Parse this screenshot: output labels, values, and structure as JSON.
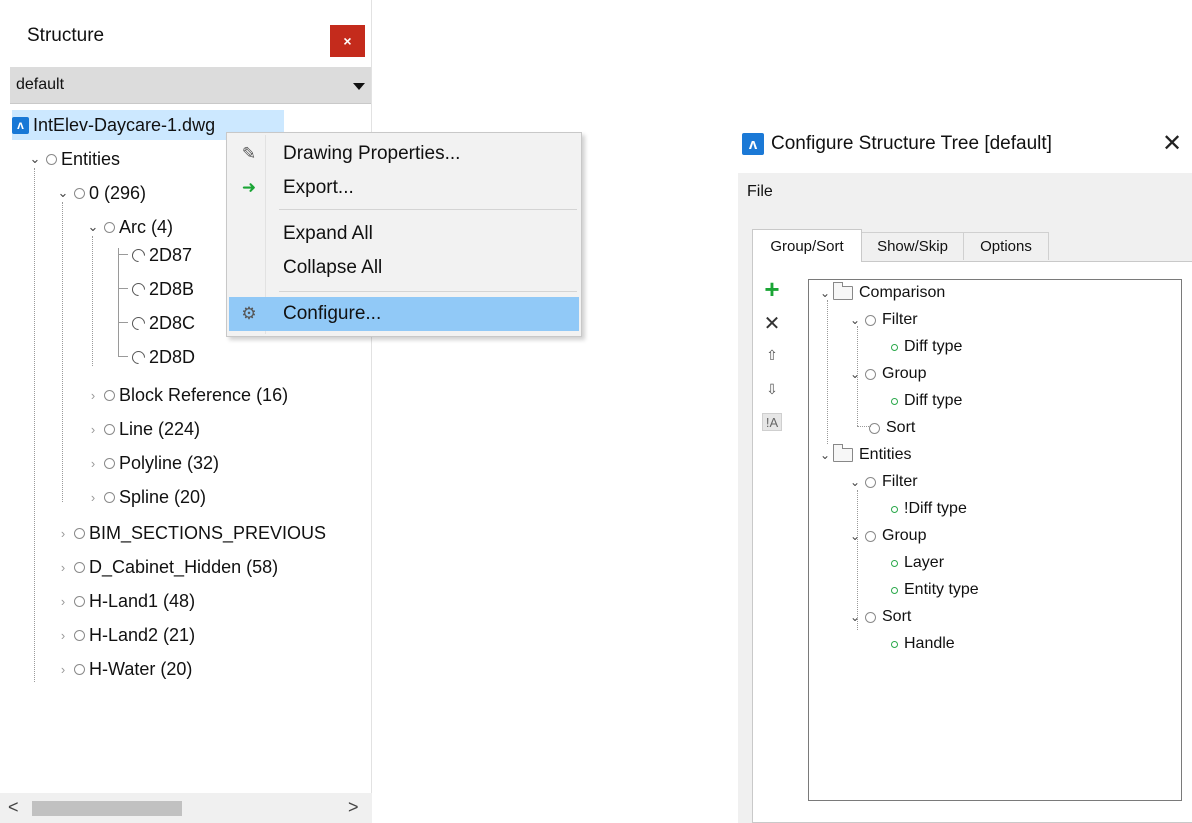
{
  "structure_panel": {
    "title": "Structure",
    "close_label": "×",
    "dropdown_value": "default",
    "tree": {
      "root": "IntElev-Daycare-1.dwg",
      "entities": "Entities",
      "layer0": "0 (296)",
      "arc": "Arc (4)",
      "arc_items": [
        "2D87",
        "2D8B",
        "2D8C",
        "2D8D"
      ],
      "block_reference": "Block Reference (16)",
      "line": "Line (224)",
      "polyline": "Polyline (32)",
      "spline": "Spline (20)",
      "bim_sections": "BIM_SECTIONS_PREVIOUS",
      "d_cabinet": "D_Cabinet_Hidden (58)",
      "h_land1": "H-Land1 (48)",
      "h_land2": "H-Land2 (21)",
      "h_water": "H-Water (20)"
    },
    "scroll_left": "<",
    "scroll_right": ">"
  },
  "context_menu": {
    "items": [
      {
        "label": "Drawing Properties...",
        "icon": "properties-icon"
      },
      {
        "label": "Export...",
        "icon": "export-icon"
      },
      {
        "label": "Expand All",
        "icon": ""
      },
      {
        "label": "Collapse All",
        "icon": ""
      },
      {
        "label": "Configure...",
        "icon": "gear-icon",
        "highlighted": true
      }
    ]
  },
  "configure_dialog": {
    "title": "Configure Structure Tree [default]",
    "close_label": "✕",
    "menu": {
      "file": "File"
    },
    "tabs": [
      "Group/Sort",
      "Show/Skip",
      "Options"
    ],
    "active_tab": "Group/Sort",
    "side_buttons": {
      "add": "+",
      "remove": "✕",
      "up": "⇧",
      "down": "⇩",
      "ia": "!A"
    },
    "tree": {
      "comparison": "Comparison",
      "comparison_filter": "Filter",
      "comparison_filter_diff": "Diff type",
      "comparison_group": "Group",
      "comparison_group_diff": "Diff type",
      "comparison_sort": "Sort",
      "entities": "Entities",
      "entities_filter": "Filter",
      "entities_filter_notdiff": "!Diff type",
      "entities_group": "Group",
      "entities_group_layer": "Layer",
      "entities_group_entity_type": "Entity type",
      "entities_sort": "Sort",
      "entities_sort_handle": "Handle"
    }
  },
  "colors": {
    "close_red": "#c42b1c",
    "selection_blue": "#cce8ff",
    "menu_highlight": "#91c9f7",
    "add_green": "#1aa535",
    "brand_blue": "#1b79d6"
  }
}
